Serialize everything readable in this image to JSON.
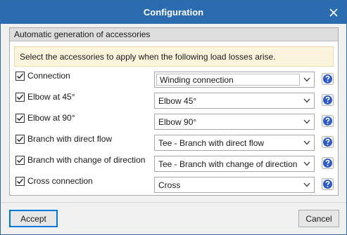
{
  "window": {
    "title": "Configuration",
    "close_icon": "close-icon"
  },
  "group": {
    "header": "Automatic generation of accessories"
  },
  "info": {
    "text": "Select the accessories to apply when the following load losses arise."
  },
  "rows": [
    {
      "label": "Connection",
      "checked": true,
      "value": "Winding connection",
      "editable": true
    },
    {
      "label": "Elbow at 45°",
      "checked": true,
      "value": "Elbow 45°",
      "editable": false
    },
    {
      "label": "Elbow at 90°",
      "checked": true,
      "value": "Elbow 90°",
      "editable": false
    },
    {
      "label": "Branch with direct flow",
      "checked": true,
      "value": "Tee - Branch with direct flow",
      "editable": false
    },
    {
      "label": "Branch with change of direction",
      "checked": true,
      "value": "Tee - Branch with change of direction",
      "editable": false
    },
    {
      "label": "Cross connection",
      "checked": true,
      "value": "Cross",
      "editable": false
    }
  ],
  "buttons": {
    "accept": "Accept",
    "cancel": "Cancel"
  },
  "colors": {
    "titlebar": "#2b6cb0",
    "info_bg": "#fcf3dc",
    "help_icon": "#2f5bc9"
  }
}
